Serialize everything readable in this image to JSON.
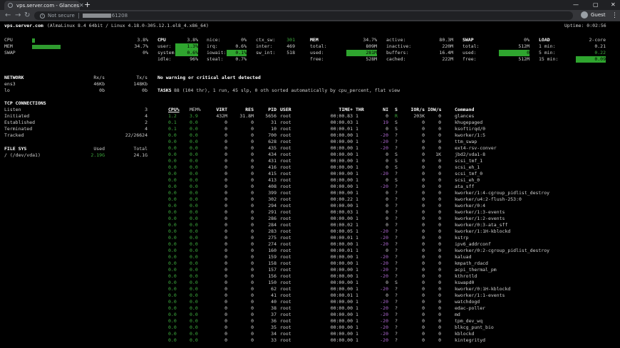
{
  "browser": {
    "tab_title": "vps.server.com - Glances",
    "new_tab": "+",
    "security_label": "Not secure",
    "url_port": "61208",
    "profile_label": "Guest"
  },
  "header": {
    "host": "vps.server.com",
    "system": "(AlmaLinux 8.4 64bit / Linux 4.18.0-305.12.1.el8_4.x86_64)",
    "uptime": "Uptime: 0:02:56"
  },
  "quicklook": [
    {
      "label": "CPU",
      "value": "3.8%",
      "bar_pct": 3.8
    },
    {
      "label": "MEM",
      "value": "34.7%",
      "bar_pct": 34.7
    },
    {
      "label": "SWAP",
      "value": "0%",
      "bar_pct": 0
    }
  ],
  "cpu": {
    "title": "CPU",
    "total": "3.8%",
    "col1": [
      [
        "user:",
        "1.3%"
      ],
      [
        "system:",
        "0.6%"
      ],
      [
        "idle:",
        "96%"
      ]
    ],
    "col2": [
      [
        "nice:",
        "0%"
      ],
      [
        "irq:",
        "0.6%"
      ],
      [
        "iowait:",
        "0.1%"
      ],
      [
        "steal:",
        "0.7%"
      ]
    ],
    "col3": [
      [
        "ctx_sw:",
        "301"
      ],
      [
        "inter:",
        "469"
      ],
      [
        "sw_int:",
        "518"
      ]
    ]
  },
  "mem": {
    "title": "MEM",
    "percent": "34.7%",
    "col1": [
      [
        "total:",
        "809M"
      ],
      [
        "used:",
        "281M"
      ],
      [
        "free:",
        "528M"
      ]
    ],
    "col2": [
      [
        "active:",
        "80.3M"
      ],
      [
        "inactive:",
        "220M"
      ],
      [
        "buffers:",
        "16.4M"
      ],
      [
        "cached:",
        "222M"
      ]
    ]
  },
  "swap": {
    "title": "SWAP",
    "percent": "0%",
    "rows": [
      [
        "total:",
        "512M"
      ],
      [
        "used:",
        "0"
      ],
      [
        "free:",
        "512M"
      ]
    ]
  },
  "load": {
    "title": "LOAD",
    "cores": "2-core",
    "rows": [
      [
        "1 min:",
        "0.21"
      ],
      [
        "5 min:",
        "0.22"
      ],
      [
        "15 min:",
        "0.09"
      ]
    ]
  },
  "network": {
    "title": "NETWORK",
    "rx": "Rx/s",
    "tx": "Tx/s",
    "rows": [
      [
        "ens3",
        "46Kb",
        "148Kb"
      ],
      [
        "lo",
        "0b",
        "0b"
      ]
    ]
  },
  "tcp": {
    "title": "TCP CONNECTIONS",
    "rows": [
      [
        "Listen",
        "3"
      ],
      [
        "Initiated",
        "4"
      ],
      [
        "Established",
        "2"
      ],
      [
        "Terminated",
        "4"
      ],
      [
        "Tracked",
        "22/26624"
      ]
    ]
  },
  "fs": {
    "title": "FILE SYS",
    "used": "Used",
    "total": "Total",
    "rows": [
      [
        "/ (/dev/vda1)",
        "2.19G",
        "24.1G"
      ]
    ]
  },
  "alert": "No warning or critical alert detected",
  "tasks": {
    "label": "TASKS",
    "text": "88 (104 thr), 1 run, 45 slp, 0 oth sorted automatically by cpu_percent, flat view"
  },
  "proc_headers": [
    "CPU%",
    "MEM%",
    "VIRT",
    "RES",
    "PID",
    "USER",
    "TIME+",
    "THR",
    "NI",
    "S",
    "IOR/s",
    "IOW/s",
    "Command"
  ],
  "processes": [
    [
      "1.2",
      "3.9",
      "432M",
      "31.8M",
      "5656",
      "root",
      "00:00.83",
      "1",
      "0",
      "R",
      "203K",
      "0",
      "glances"
    ],
    [
      "0.1",
      "0.0",
      "0",
      "0",
      "31",
      "root",
      "00:00.03",
      "1",
      "19",
      "S",
      "0",
      "0",
      "khugepaged"
    ],
    [
      "0.1",
      "0.0",
      "0",
      "0",
      "10",
      "root",
      "00:00.01",
      "1",
      "0",
      "S",
      "0",
      "0",
      "ksoftirqd/0"
    ],
    [
      "0.0",
      "0.0",
      "0",
      "0",
      "700",
      "root",
      "00:00.00",
      "1",
      "-20",
      "?",
      "0",
      "0",
      "kworker/1:5"
    ],
    [
      "0.0",
      "0.0",
      "0",
      "0",
      "628",
      "root",
      "00:00.00",
      "1",
      "-20",
      "?",
      "0",
      "0",
      "ttm_swap"
    ],
    [
      "0.0",
      "0.0",
      "0",
      "0",
      "435",
      "root",
      "00:00.00",
      "1",
      "-20",
      "?",
      "0",
      "0",
      "ext4-rsv-conver"
    ],
    [
      "0.0",
      "0.0",
      "0",
      "0",
      "434",
      "root",
      "00:00.00",
      "1",
      "0",
      "S",
      "0",
      "1K",
      "jbd2/vda1-8"
    ],
    [
      "0.0",
      "0.0",
      "0",
      "0",
      "431",
      "root",
      "00:00.00",
      "1",
      "0",
      "S",
      "0",
      "0",
      "scsi_tmf_1"
    ],
    [
      "0.0",
      "0.0",
      "0",
      "0",
      "416",
      "root",
      "00:00.00",
      "1",
      "0",
      "S",
      "0",
      "0",
      "scsi_eh_1"
    ],
    [
      "0.0",
      "0.0",
      "0",
      "0",
      "415",
      "root",
      "00:00.00",
      "1",
      "-20",
      "?",
      "0",
      "0",
      "scsi_tmf_0"
    ],
    [
      "0.0",
      "0.0",
      "0",
      "0",
      "413",
      "root",
      "00:00.00",
      "1",
      "0",
      "S",
      "0",
      "0",
      "scsi_eh_0"
    ],
    [
      "0.0",
      "0.0",
      "0",
      "0",
      "408",
      "root",
      "00:00.00",
      "1",
      "-20",
      "?",
      "0",
      "0",
      "ata_sff"
    ],
    [
      "0.0",
      "0.0",
      "0",
      "0",
      "399",
      "root",
      "00:00.00",
      "1",
      "0",
      "?",
      "0",
      "0",
      "kworker/1:4-cgroup_pidlist_destroy"
    ],
    [
      "0.0",
      "0.0",
      "0",
      "0",
      "302",
      "root",
      "00:00.22",
      "1",
      "0",
      "?",
      "0",
      "0",
      "kworker/u4:2-flush-253:0"
    ],
    [
      "0.0",
      "0.0",
      "0",
      "0",
      "294",
      "root",
      "00:00.00",
      "1",
      "0",
      "?",
      "0",
      "0",
      "kworker/0:4"
    ],
    [
      "0.0",
      "0.0",
      "0",
      "0",
      "291",
      "root",
      "00:00.03",
      "1",
      "0",
      "?",
      "0",
      "0",
      "kworker/1:3-events"
    ],
    [
      "0.0",
      "0.0",
      "0",
      "0",
      "286",
      "root",
      "00:00.00",
      "1",
      "0",
      "?",
      "0",
      "0",
      "kworker/1:2-events"
    ],
    [
      "0.0",
      "0.0",
      "0",
      "0",
      "284",
      "root",
      "00:00.02",
      "1",
      "0",
      "?",
      "0",
      "0",
      "kworker/0:3-ata_sff"
    ],
    [
      "0.0",
      "0.0",
      "0",
      "0",
      "283",
      "root",
      "00:00.05",
      "1",
      "-20",
      "?",
      "0",
      "0",
      "kworker/1:1H-kblockd"
    ],
    [
      "0.0",
      "0.0",
      "0",
      "0",
      "275",
      "root",
      "00:00.01",
      "1",
      "-20",
      "?",
      "0",
      "0",
      "kstrp"
    ],
    [
      "0.0",
      "0.0",
      "0",
      "0",
      "274",
      "root",
      "00:00.00",
      "1",
      "-20",
      "?",
      "0",
      "0",
      "ipv6_addrconf"
    ],
    [
      "0.0",
      "0.0",
      "0",
      "0",
      "160",
      "root",
      "00:00.01",
      "1",
      "0",
      "?",
      "0",
      "0",
      "kworker/0:2-cgroup_pidlist_destroy"
    ],
    [
      "0.0",
      "0.0",
      "0",
      "0",
      "159",
      "root",
      "00:00.00",
      "1",
      "-20",
      "?",
      "0",
      "0",
      "kaluad"
    ],
    [
      "0.0",
      "0.0",
      "0",
      "0",
      "158",
      "root",
      "00:00.00",
      "1",
      "-20",
      "?",
      "0",
      "0",
      "kmpath_rdacd"
    ],
    [
      "0.0",
      "0.0",
      "0",
      "0",
      "157",
      "root",
      "00:00.00",
      "1",
      "-20",
      "?",
      "0",
      "0",
      "acpi_thermal_pm"
    ],
    [
      "0.0",
      "0.0",
      "0",
      "0",
      "156",
      "root",
      "00:00.00",
      "1",
      "-20",
      "?",
      "0",
      "0",
      "kthrotld"
    ],
    [
      "0.0",
      "0.0",
      "0",
      "0",
      "150",
      "root",
      "00:00.00",
      "1",
      "0",
      "S",
      "0",
      "0",
      "kswapd0"
    ],
    [
      "0.0",
      "0.0",
      "0",
      "0",
      "62",
      "root",
      "00:00.00",
      "1",
      "-20",
      "?",
      "0",
      "0",
      "kworker/0:1H-kblockd"
    ],
    [
      "0.0",
      "0.0",
      "0",
      "0",
      "41",
      "root",
      "00:00.01",
      "1",
      "0",
      "?",
      "0",
      "0",
      "kworker/1:1-events"
    ],
    [
      "0.0",
      "0.0",
      "0",
      "0",
      "40",
      "root",
      "00:00.00",
      "1",
      "-20",
      "?",
      "0",
      "0",
      "watchdogd"
    ],
    [
      "0.0",
      "0.0",
      "0",
      "0",
      "38",
      "root",
      "00:00.00",
      "1",
      "-20",
      "?",
      "0",
      "0",
      "edac-poller"
    ],
    [
      "0.0",
      "0.0",
      "0",
      "0",
      "37",
      "root",
      "00:00.00",
      "1",
      "-20",
      "?",
      "0",
      "0",
      "md"
    ],
    [
      "0.0",
      "0.0",
      "0",
      "0",
      "36",
      "root",
      "00:00.00",
      "1",
      "-20",
      "?",
      "0",
      "0",
      "tpm_dev_wq"
    ],
    [
      "0.0",
      "0.0",
      "0",
      "0",
      "35",
      "root",
      "00:00.00",
      "1",
      "-20",
      "?",
      "0",
      "0",
      "blkcg_punt_bio"
    ],
    [
      "0.0",
      "0.0",
      "0",
      "0",
      "34",
      "root",
      "00:00.00",
      "1",
      "-20",
      "?",
      "0",
      "0",
      "kblockd"
    ],
    [
      "0.0",
      "0.0",
      "0",
      "0",
      "33",
      "root",
      "00:00.00",
      "1",
      "-20",
      "?",
      "0",
      "0",
      "kintegrityd"
    ]
  ]
}
